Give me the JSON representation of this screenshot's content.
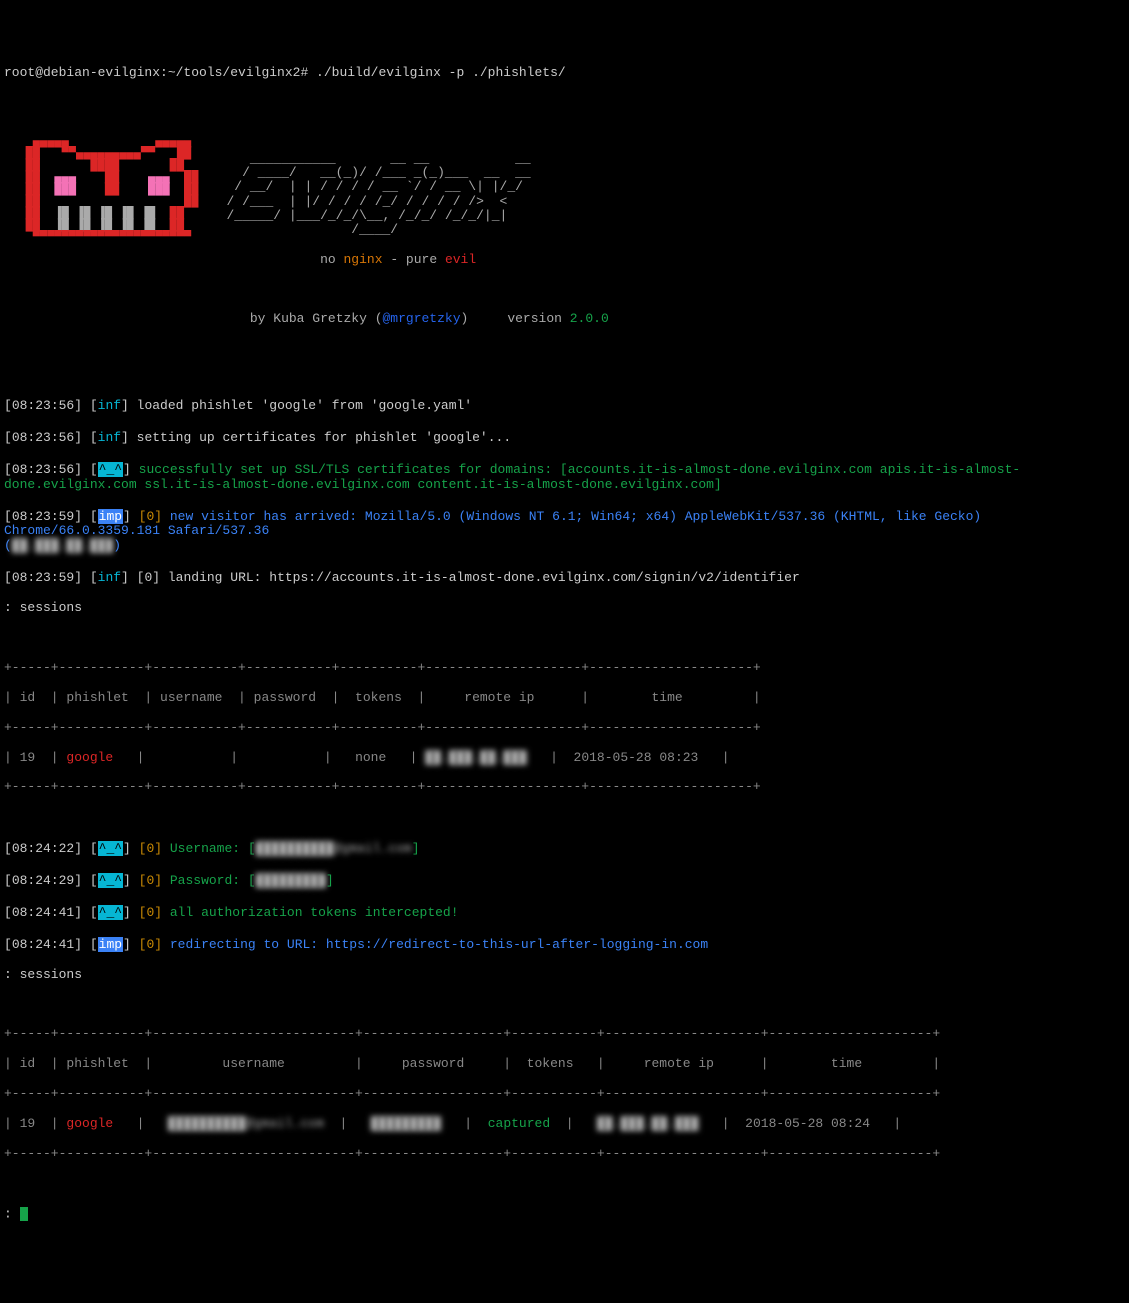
{
  "prompt": "root@debian-evilginx:~/tools/evilginx2# ./build/evilginx -p ./phishlets/",
  "banner": {
    "ascii_lines": [
      "   ___________       __ __              __               ",
      "  / ____/   __(_)/ /___ _(_)___  __  __        ",
      " / __/  | | / / / / __ `/ / __ \\\\| |/_/      ",
      "/ /___  | |/ / / / /_/ / / / / />  <           ",
      "/_____/  |___/_/_/\\\\__, /_/_/ /_/_/|_|         ",
      "               /____/                         "
    ],
    "tagline_pre": "no ",
    "tagline_nginx": "nginx",
    "tagline_mid": " - pure ",
    "tagline_evil": "evil",
    "byline_pre": "by Kuba Gretzky (",
    "handle": "@mrgretzky",
    "byline_post": ")     version ",
    "version": "2.0.0"
  },
  "logs": {
    "l1": {
      "ts": "08:23:56",
      "tag": "inf",
      "msg": "loaded phishlet 'google' from 'google.yaml'"
    },
    "l2": {
      "ts": "08:23:56",
      "tag": "inf",
      "msg": "setting up certificates for phishlet 'google'..."
    },
    "l3": {
      "ts": "08:23:56",
      "tag": "^_^",
      "msg": "successfully set up SSL/TLS certificates for domains: [accounts.it-is-almost-done.evilginx.com apis.it-is-almost-done.evilginx.com ssl.it-is-almost-done.evilginx.com content.it-is-almost-done.evilginx.com]"
    },
    "l4": {
      "ts": "08:23:59",
      "tag": "imp",
      "id": "[0]",
      "msg": "new visitor has arrived: Mozilla/5.0 (Windows NT 6.1; Win64; x64) AppleWebKit/537.36 (KHTML, like Gecko) Chrome/66.0.3359.181 Safari/537.36"
    },
    "l4ip_open": "(",
    "l4ip": "██.███.██.███",
    "l4ip_close": ")",
    "l5": {
      "ts": "08:23:59",
      "tag": "inf",
      "msg": "[0] landing URL: https://accounts.it-is-almost-done.evilginx.com/signin/v2/identifier"
    },
    "sessions1": ": sessions"
  },
  "table1": {
    "border": "+-----+-----------+-----------+-----------+----------+--------------------+---------------------+",
    "header": "| id  | phishlet  | username  | password  |  tokens  |     remote ip      |        time         |",
    "row_id": "| 19  | ",
    "row_phishlet": "google",
    "row_mid": "   |           |           |   none   | ",
    "row_ip": "██.███.██.███",
    "row_end": "   |  2018-05-28 08:23   |"
  },
  "logs2": {
    "l6": {
      "ts": "08:24:22",
      "tag": "^_^",
      "id": "[0]",
      "pre": "Username: [",
      "val": "██████████@gmail.com",
      "post": "]"
    },
    "l7": {
      "ts": "08:24:29",
      "tag": "^_^",
      "id": "[0]",
      "pre": "Password: [",
      "val": "█████████",
      "post": "]"
    },
    "l8": {
      "ts": "08:24:41",
      "tag": "^_^",
      "id": "[0]",
      "msg": "all authorization tokens intercepted!"
    },
    "l9": {
      "ts": "08:24:41",
      "tag": "imp",
      "id": "[0]",
      "msg": "redirecting to URL: https://redirect-to-this-url-after-logging-in.com"
    },
    "sessions2": ": sessions"
  },
  "table2": {
    "border": "+-----+-----------+--------------------------+------------------+-----------+--------------------+---------------------+",
    "header": "| id  | phishlet  |         username         |     password     |  tokens   |     remote ip      |        time         |",
    "row_id": "| 19  | ",
    "row_phishlet": "google",
    "row_mid1": "   |   ",
    "row_user": "██████████@gmail.com",
    "row_mid2": "  |   ",
    "row_pass": "█████████",
    "row_mid3": "   |  ",
    "row_tok": "captured",
    "row_mid4": "  |   ",
    "row_ip": "██.███.██.███",
    "row_end": "   |  2018-05-28 08:24   |"
  },
  "prompt2": ": "
}
